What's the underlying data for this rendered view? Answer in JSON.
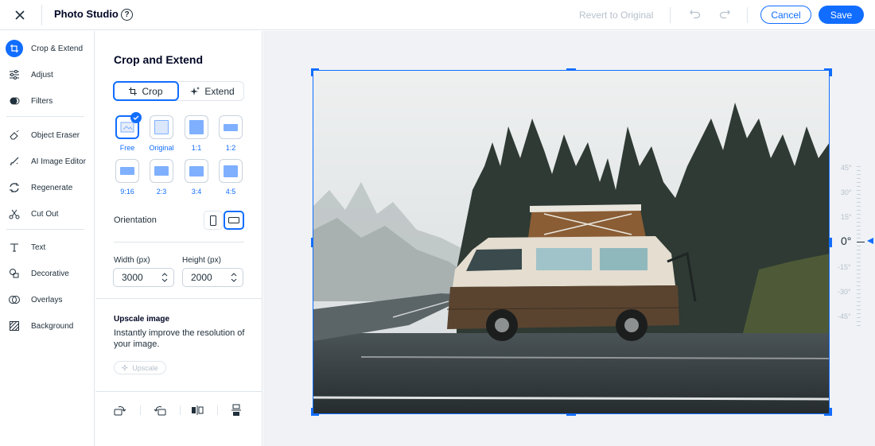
{
  "header": {
    "title": "Photo Studio",
    "help": "?",
    "revert_label": "Revert to Original",
    "cancel_label": "Cancel",
    "save_label": "Save"
  },
  "sidebar": {
    "items": [
      {
        "label": "Crop & Extend",
        "icon": "crop-extend-icon",
        "active": true
      },
      {
        "label": "Adjust",
        "icon": "sliders-icon"
      },
      {
        "label": "Filters",
        "icon": "filters-icon"
      },
      {
        "label": "Object Eraser",
        "icon": "eraser-icon"
      },
      {
        "label": "AI Image Editor",
        "icon": "ai-brush-icon"
      },
      {
        "label": "Regenerate",
        "icon": "regenerate-icon"
      },
      {
        "label": "Cut Out",
        "icon": "scissors-icon"
      },
      {
        "label": "Text",
        "icon": "text-icon"
      },
      {
        "label": "Decorative",
        "icon": "decorative-icon"
      },
      {
        "label": "Overlays",
        "icon": "overlays-icon"
      },
      {
        "label": "Background",
        "icon": "background-icon"
      }
    ]
  },
  "panel": {
    "title": "Crop and Extend",
    "tabs": {
      "crop": "Crop",
      "extend": "Extend",
      "selected": "Crop"
    },
    "ratios": [
      {
        "label": "Free",
        "selected": true
      },
      {
        "label": "Original"
      },
      {
        "label": "1:1"
      },
      {
        "label": "1:2"
      },
      {
        "label": "9:16"
      },
      {
        "label": "2:3"
      },
      {
        "label": "3:4"
      },
      {
        "label": "4:5"
      }
    ],
    "orientation_label": "Orientation",
    "orientation_selected": "landscape",
    "width_label": "Width (px)",
    "width_value": "3000",
    "height_label": "Height (px)",
    "height_value": "2000",
    "upscale": {
      "title": "Upscale image",
      "description": "Instantly improve the resolution of your image.",
      "button": "Upscale"
    }
  },
  "canvas": {
    "rotation_labels": [
      "45°",
      "30°",
      "15°",
      "0°",
      "-15°",
      "-30°",
      "-45°"
    ],
    "rotation_value": "0°"
  },
  "colors": {
    "accent": "#116dff",
    "text": "#20303c",
    "border": "#dfe5eb",
    "canvas_bg": "#f0f2f5"
  }
}
